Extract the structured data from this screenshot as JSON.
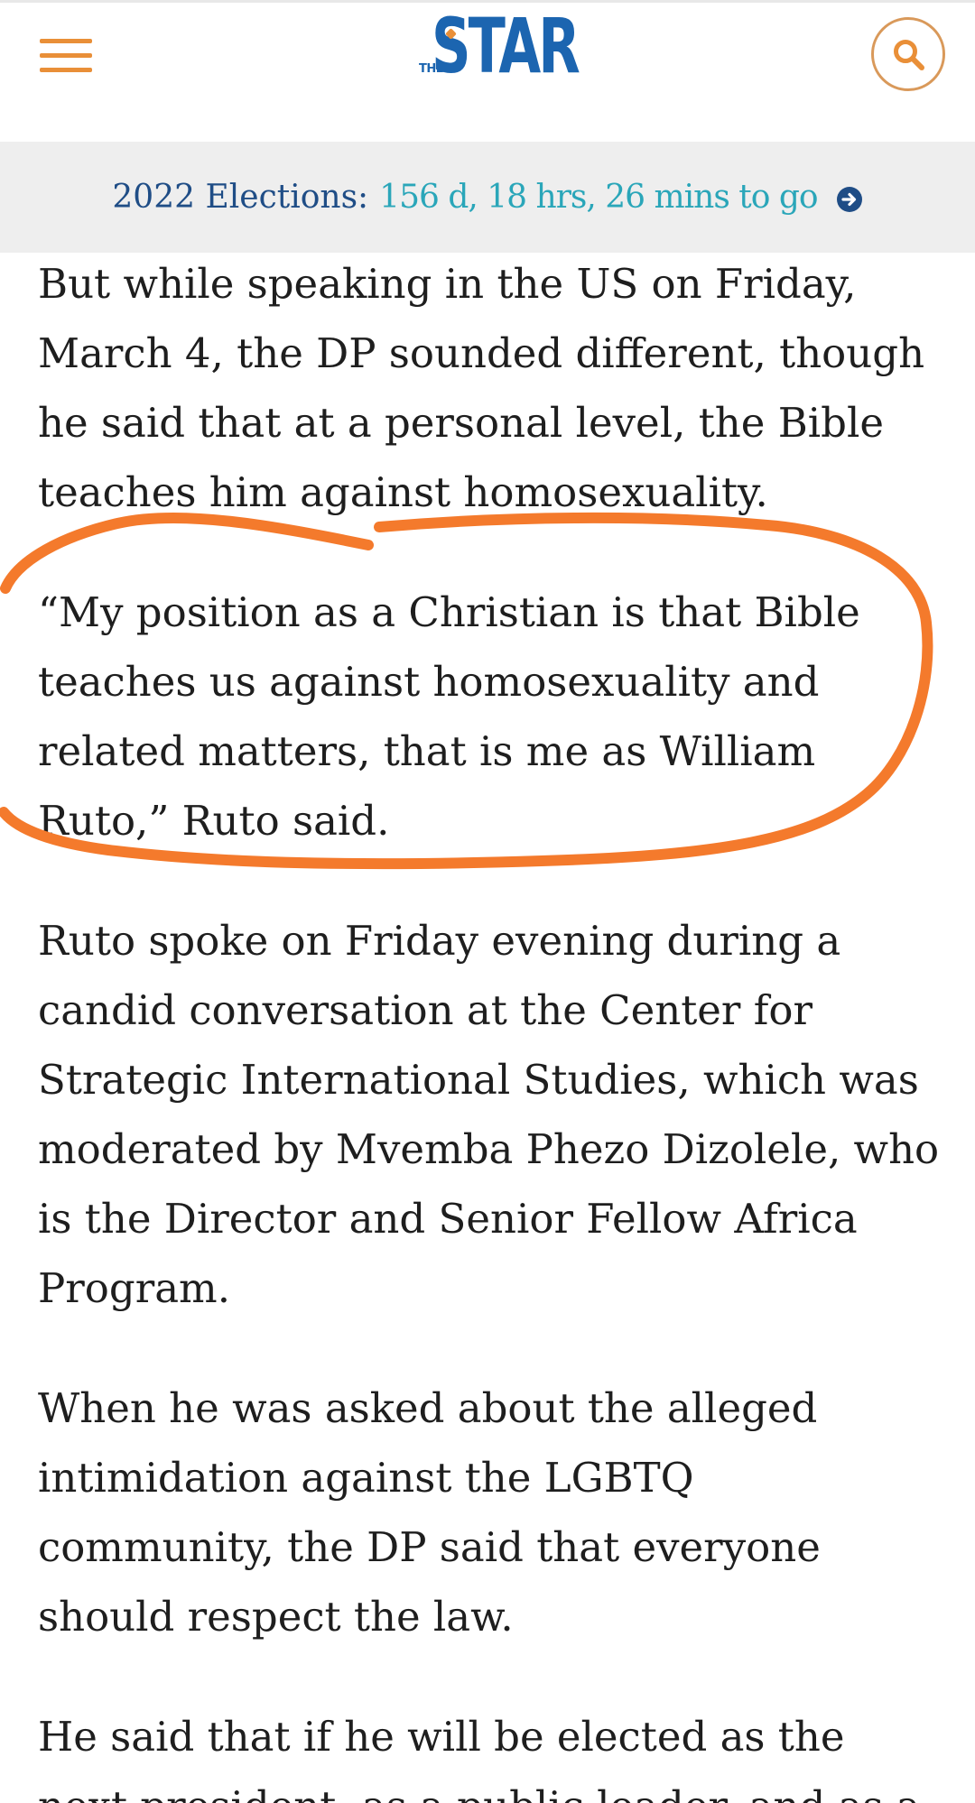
{
  "header": {
    "logo": {
      "small": "THE",
      "main": "STAR"
    },
    "menu_icon": "hamburger-menu-icon",
    "search_icon": "search-icon",
    "accent_color": "#e98f38",
    "brand_color": "#1c65b0"
  },
  "banner": {
    "label": "2022 Elections:",
    "countdown": "156 d, 18 hrs, 26 mins to go",
    "arrow_icon": "arrow-right-circle-icon"
  },
  "article": {
    "paragraphs": [
      "But while speaking in the US on Friday, March 4, the DP sounded different, though he said that at a personal level, the Bible teaches him against homosexuality.",
      "“My position as a Christian is that Bible teaches us against homosexuality and related matters, that is me as William Ruto,” Ruto said.",
      "Ruto spoke on Friday evening during a candid conversation at the Center for Strategic International Studies, which was moderated by Mvemba Phezo Dizolele, who is the Director and Senior Fellow Africa Program.",
      "When he was asked about the alleged intimidation against the LGBTQ community, the DP said that everyone should respect the law.",
      "He said that if he will be elected as the next president, as a public leader, and as a"
    ]
  },
  "annotation": {
    "color": "#f47a2c"
  }
}
